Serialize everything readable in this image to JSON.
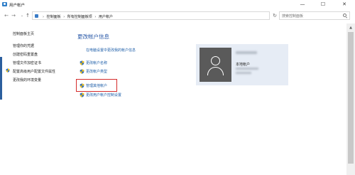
{
  "window": {
    "title": "用户帐户",
    "controls": {
      "minimize": "—",
      "maximize": "☐",
      "close": "✕"
    }
  },
  "address": {
    "breadcrumbs": [
      "控制面板",
      "所有控制面板项",
      "用户帐户"
    ],
    "separator": "›",
    "dropdown": "⌄",
    "refresh": "↻"
  },
  "search": {
    "placeholder": "搜索控制面板"
  },
  "nav": {
    "back": "←",
    "forward": "→",
    "recent": "⌄",
    "up": "↑"
  },
  "sidebar": {
    "title": "控制面板主页",
    "items": [
      {
        "label": "管理你的凭据",
        "shield": false
      },
      {
        "label": "创建密码重置盘",
        "shield": false
      },
      {
        "label": "管理文件加密证书",
        "shield": false
      },
      {
        "label": "配置高级用户配置文件属性",
        "shield": true
      },
      {
        "label": "更改我的环境变量",
        "shield": false
      }
    ]
  },
  "main": {
    "heading": "更改帐户信息",
    "settings_link": "在电脑设置中更改我的帐户信息",
    "links": [
      {
        "label": "更改帐户名称",
        "shield": true
      },
      {
        "label": "更改帐户类型",
        "shield": true
      }
    ],
    "links2": [
      {
        "label": "管理其他帐户",
        "shield": true,
        "highlighted": true
      },
      {
        "label": "更改用户帐户控制设置",
        "shield": true,
        "highlighted": false
      }
    ]
  },
  "account": {
    "type": "本地帐户",
    "colors": {
      "card": "#e6ecf5",
      "avatar": "#5a5a5a"
    }
  },
  "colors": {
    "link": "#1c5da8",
    "heading": "#2b5aa8",
    "highlight": "#d42b2b"
  }
}
